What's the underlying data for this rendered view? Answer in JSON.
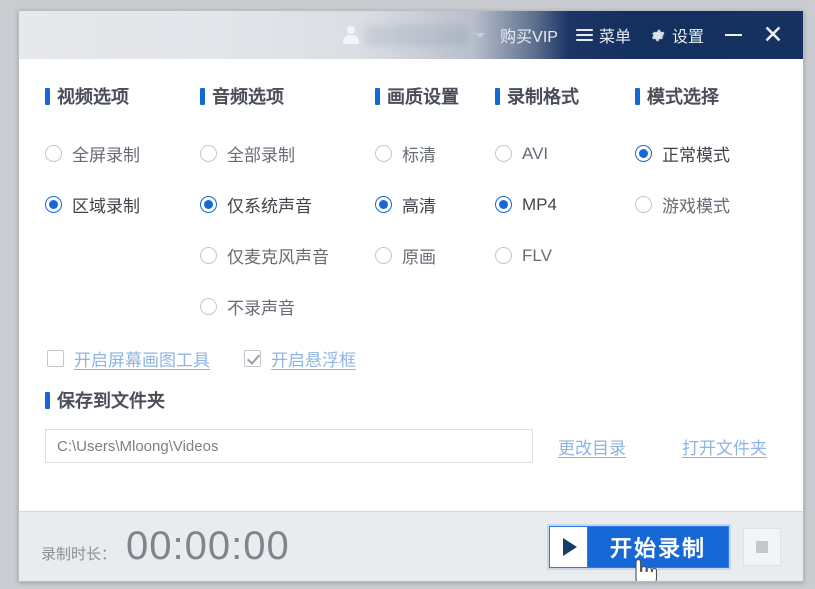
{
  "titlebar": {
    "user_icon": "user-icon",
    "user_name_redacted": "",
    "buy_vip_label": "购买VIP",
    "menu_label": "菜单",
    "menu_icon": "hamburger-icon",
    "settings_label": "设置",
    "settings_icon": "gear-icon",
    "minimize_label": "",
    "close_label": "✕",
    "bg_color": "#15315f"
  },
  "accent_color": "#1668d6",
  "columns": [
    {
      "key": "video",
      "title": "视频选项",
      "options": [
        {
          "label": "全屏录制",
          "checked": false
        },
        {
          "label": "区域录制",
          "checked": true
        }
      ]
    },
    {
      "key": "audio",
      "title": "音频选项",
      "options": [
        {
          "label": "全部录制",
          "checked": false
        },
        {
          "label": "仅系统声音",
          "checked": true
        },
        {
          "label": "仅麦克风声音",
          "checked": false
        },
        {
          "label": "不录声音",
          "checked": false
        }
      ]
    },
    {
      "key": "quality",
      "title": "画质设置",
      "options": [
        {
          "label": "标清",
          "checked": false
        },
        {
          "label": "高清",
          "checked": true
        },
        {
          "label": "原画",
          "checked": false
        }
      ]
    },
    {
      "key": "format",
      "title": "录制格式",
      "options": [
        {
          "label": "AVI",
          "checked": false
        },
        {
          "label": "MP4",
          "checked": true
        },
        {
          "label": "FLV",
          "checked": false
        }
      ]
    },
    {
      "key": "mode",
      "title": "模式选择",
      "options": [
        {
          "label": "正常模式",
          "checked": true
        },
        {
          "label": "游戏模式",
          "checked": false
        }
      ]
    }
  ],
  "checkboxes": [
    {
      "label": "开启屏幕画图工具",
      "checked": false
    },
    {
      "label": "开启悬浮框",
      "checked": true
    }
  ],
  "save": {
    "title": "保存到文件夹",
    "path_value": "C:\\Users\\Mloong\\Videos",
    "path_placeholder": "C:\\Users\\Mloong\\Videos",
    "change_dir_label": "更改目录",
    "open_folder_label": "打开文件夹"
  },
  "footer": {
    "duration_label": "录制时长：",
    "duration_value": "00:00:00",
    "start_label": "开始录制",
    "play_icon": "play-icon",
    "stop_icon": "stop-icon"
  }
}
